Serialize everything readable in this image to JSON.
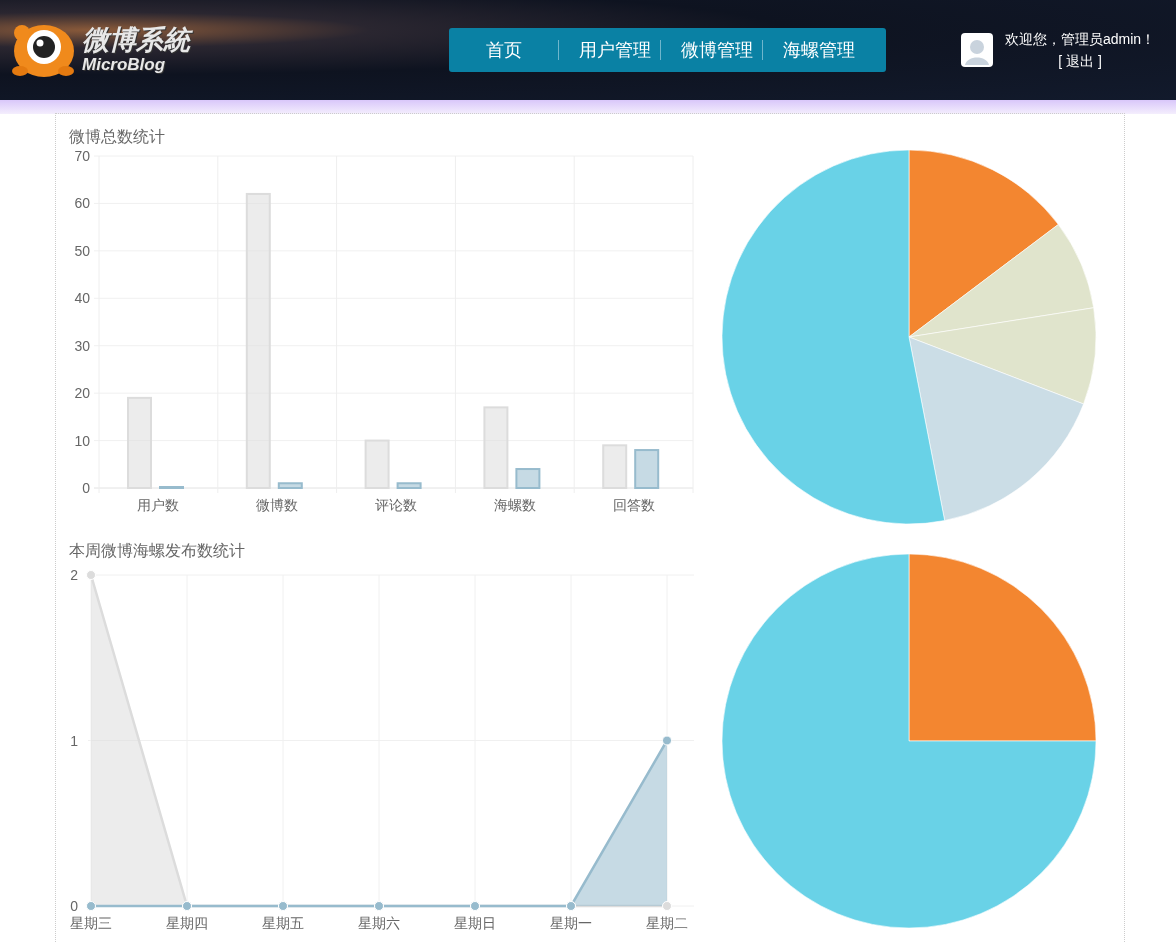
{
  "header": {
    "logo": {
      "title": "微博系統",
      "subtitle": "MicroBlog"
    },
    "nav": [
      {
        "label": "首页"
      },
      {
        "label": "用户管理"
      },
      {
        "label": "微博管理"
      },
      {
        "label": "海螺管理"
      }
    ],
    "user": {
      "greeting": "欢迎您，管理员admin！",
      "logout": "[ 退出 ]"
    }
  },
  "charts": [
    {
      "title": "微博总数统计",
      "chart_data": {
        "type": "bar",
        "grid": true,
        "categories": [
          "用户数",
          "微博数",
          "评论数",
          "海螺数",
          "回答数"
        ],
        "ylim": [
          0,
          70
        ],
        "yticks": [
          0,
          10,
          20,
          30,
          40,
          50,
          60,
          70
        ],
        "series": [
          {
            "color": "#dcdcdc",
            "values": [
              19,
              62,
              10,
              17,
              9
            ]
          },
          {
            "color": "#97bbcd",
            "values": [
              0,
              1,
              1,
              4,
              8
            ]
          }
        ]
      }
    },
    {
      "title": "本周微博海螺发布数统计",
      "chart_data": {
        "type": "area",
        "grid": true,
        "categories": [
          "星期三",
          "星期四",
          "星期五",
          "星期六",
          "星期日",
          "星期一",
          "星期二"
        ],
        "ylim": [
          0,
          2
        ],
        "yticks": [
          0,
          1,
          2
        ],
        "series": [
          {
            "color": "#dcdcdc",
            "values": [
              2,
              0,
              0,
              0,
              0,
              0,
              0
            ]
          },
          {
            "color": "#97bbcd",
            "values": [
              0,
              0,
              0,
              0,
              0,
              0,
              1
            ]
          }
        ]
      }
    }
  ]
}
